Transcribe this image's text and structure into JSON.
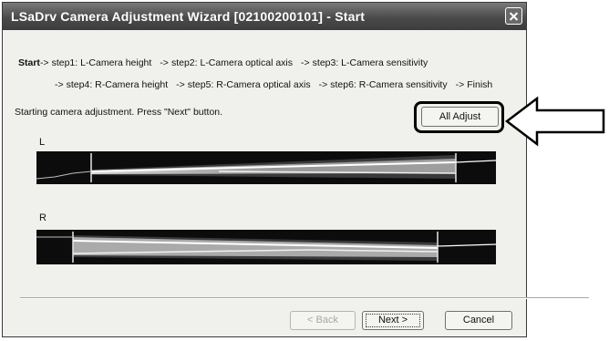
{
  "window": {
    "title": "LSaDrv Camera Adjustment Wizard [02100200101] - Start"
  },
  "steps": {
    "start": "Start",
    "arrow": "->",
    "row1": [
      "step1: L-Camera height",
      "step2: L-Camera optical axis",
      "step3: L-Camera sensitivity"
    ],
    "row2": [
      "step4: R-Camera height",
      "step5: R-Camera optical axis",
      "step6: R-Camera sensitivity",
      "Finish"
    ]
  },
  "message": "Starting camera adjustment. Press \"Next\" button.",
  "buttons": {
    "all_adjust": "All Adjust",
    "back": "< Back",
    "next": "Next >",
    "cancel": "Cancel"
  },
  "camera_labels": {
    "left": "L",
    "right": "R"
  },
  "icons": {
    "close": "close-icon",
    "callout": "arrow-left-callout-icon"
  }
}
